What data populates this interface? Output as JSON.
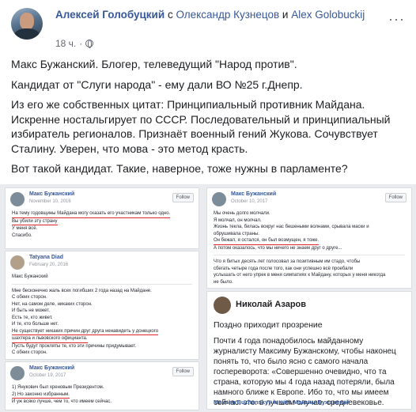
{
  "header": {
    "author": "Алексей Голобуцкий",
    "with_word": "с",
    "with_person1": "Олександр Кузнецов",
    "and_word": "и",
    "with_person2": "Alex Golobuckij",
    "time": "18 ч.",
    "more": "···"
  },
  "post": {
    "p1": "Макс Бужанский. Блогер, телеведущий \"Народ против\".",
    "p2": "Кандидат от \"Слуги народа\" - ему дали ВО №25 г.Днепр.",
    "p3": "Из его же собственных цитат: Принципиальный противник Майдана. Искренне ностальгирует по СССР. Последовательный и принципиальный избиратель регионалов. Признаёт военный гений Жукова. Сочувствует Сталину. Уверен, что мова - это метод красть.",
    "p4": "Вот такой кандидат. Такие, наверное, тоже нужны в парламенте?"
  },
  "shots": {
    "s1": {
      "name": "Макс Бужанский",
      "date": "November 10, 2016",
      "follow": "Follow",
      "lines": [
        "На тему годовщины Майдана могу сказать его участникам только одно.",
        "Вы убили эту страну",
        "У меня всё.",
        "Спасибо."
      ]
    },
    "s2": {
      "name": "Tatyana Diad",
      "date": "February 20, 2016",
      "lines": [
        "Макс Бужанский",
        "Мне бесконечно жаль всех погибших 2 года назад на Майдане.",
        "С обеих сторон.",
        "Нет, на самом деле, никаких сторон.",
        "И быть не может.",
        "Есть те, кто живет.",
        "И те, кто больше нет.",
        "Не существует никаких причин друг друга ненавидеть у донецкого",
        "шахтера и львовского официанта.",
        "Пусть будут прокляты те, кто эти причины придумывает.",
        "С обеих сторон."
      ]
    },
    "s3": {
      "name": "Макс Бужанский",
      "date": "October 19, 2017",
      "follow": "Follow",
      "lines": [
        "1) Янукович был хреновым Президентом.",
        "2) Но законно избранным.",
        "",
        "И уж всяко лучше, чем то, что имеем сейчас."
      ]
    },
    "s4": {
      "name": "Макс Бужанский",
      "date": "October 10, 2017",
      "follow": "Follow",
      "lines": [
        "Мы очень долго молчали.",
        "Я молчал, он молчал.",
        "Жизнь текла, билась вокруг нас бешеными волнами, срывала маски и",
        "обрушивала страны.",
        "Он бежал, я остался, он был возмущен, я тоже.",
        "А потом оказалось, что мы ничего не знаем друг о друге..."
      ],
      "tail": [
        "Что я битых десять лет голосовал за позитивным им стадо, чтобы",
        "сбегать четыре года после того, как они успешно всё проебали",
        "услышать от него упрек в меня симпатиях к Майдану, которых у меня никогда",
        "не было."
      ]
    },
    "quote": {
      "name": "Николай Азаров",
      "title": "Поздно приходит прозрение",
      "text": "Почти 4 года понадобилось майданному журналисту Максиму Бужанскому, чтобы наконец понять то, что было ясно с самого начала госпереворота: «Совершенно очевидно, что та страна, которую мы 4 года назад потеряли, была намного ближе к Европе. Ибо то, что мы имеем сейчас. это. в лучшем случае. средневековье.",
      "footer": "Maksim Buzhanskyy is with Максим Бужанский"
    }
  }
}
